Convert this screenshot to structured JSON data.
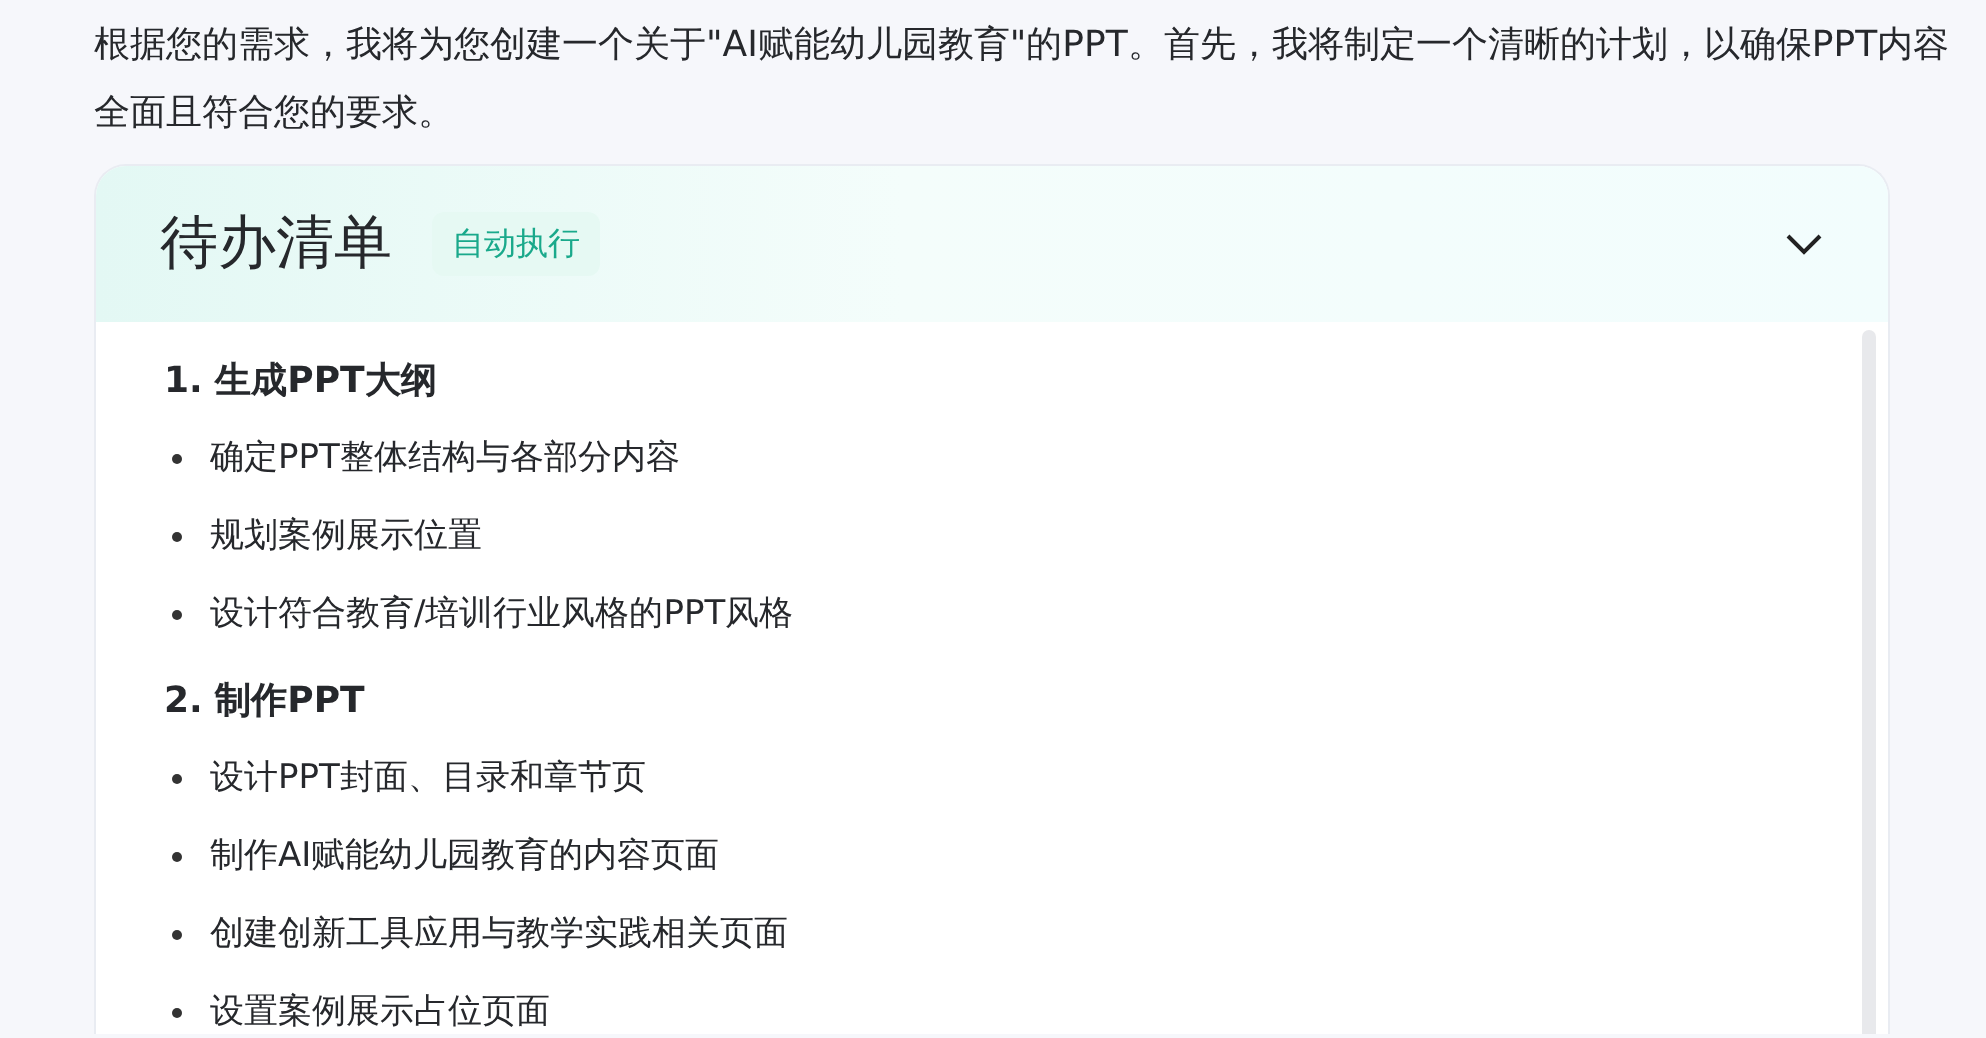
{
  "intro": "根据您的需求，我将为您创建一个关于\"AI赋能幼儿园教育\"的PPT。首先，我将制定一个清晰的计划，以确保PPT内容全面且符合您的要求。",
  "todo": {
    "title": "待办清单",
    "badge": "自动执行",
    "expanded": true,
    "sections": [
      {
        "title": "1. 生成PPT大纲",
        "items": [
          "确定PPT整体结构与各部分内容",
          "规划案例展示位置",
          "设计符合教育/培训行业风格的PPT风格"
        ]
      },
      {
        "title": "2. 制作PPT",
        "items": [
          "设计PPT封面、目录和章节页",
          "制作AI赋能幼儿园教育的内容页面",
          "创建创新工具应用与教学实践相关页面",
          "设置案例展示占位页面"
        ]
      }
    ]
  }
}
